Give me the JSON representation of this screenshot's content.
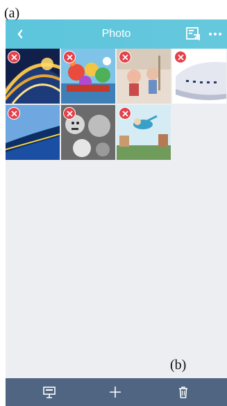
{
  "figure": {
    "label_a": "(a)",
    "label_b": "(b)"
  },
  "header": {
    "title": "Photo",
    "back_icon": "chevron-left-icon",
    "share_icon": "export-icon",
    "more_icon": "more-dots-icon"
  },
  "photos": [
    {
      "name": "architecture-arches",
      "delete_icon": "remove-icon"
    },
    {
      "name": "colorful-festival",
      "delete_icon": "remove-icon"
    },
    {
      "name": "cartoon-characters",
      "delete_icon": "remove-icon"
    },
    {
      "name": "white-building",
      "delete_icon": "remove-icon"
    },
    {
      "name": "blue-building",
      "delete_icon": "remove-icon"
    },
    {
      "name": "monochrome-figures",
      "delete_icon": "remove-icon"
    },
    {
      "name": "flying-character",
      "delete_icon": "remove-icon"
    }
  ],
  "toolbar": {
    "items": [
      "presentation-icon",
      "add-icon",
      "trash-icon"
    ]
  },
  "colors": {
    "header": "#5cc5dc",
    "toolbar": "#4f6582",
    "content_bg": "#eceef1",
    "delete_badge": "#e4414b"
  }
}
